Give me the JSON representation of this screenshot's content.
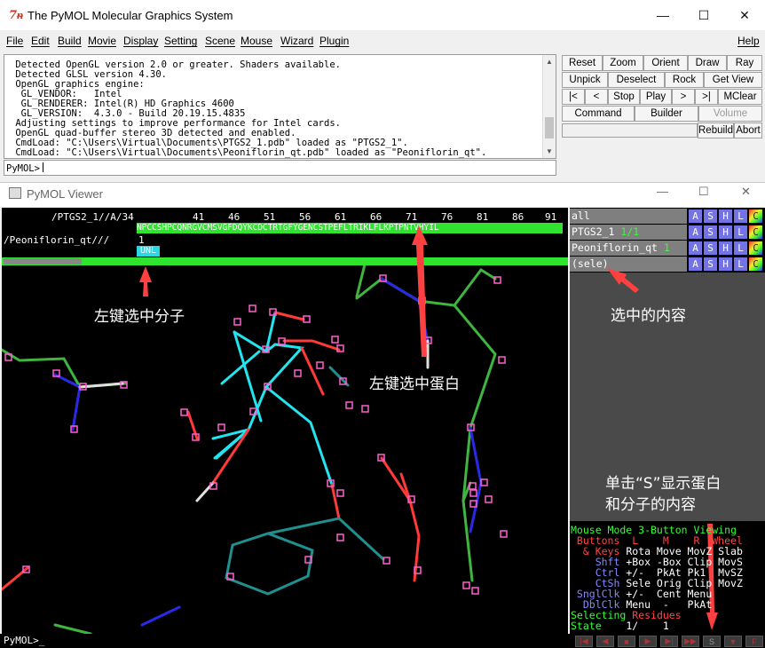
{
  "window": {
    "title": "The PyMOL Molecular Graphics System",
    "minimize": "—",
    "maximize": "☐",
    "close": "✕"
  },
  "menu": [
    "File",
    "Edit",
    "Build",
    "Movie",
    "Display",
    "Setting",
    "Scene",
    "Mouse",
    "Wizard",
    "Plugin"
  ],
  "help_label": "Help",
  "console_lines": [
    " Detected OpenGL version 2.0 or greater. Shaders available.",
    " Detected GLSL version 4.30.",
    " OpenGL graphics engine:",
    "  GL_VENDOR:   Intel",
    "  GL_RENDERER: Intel(R) HD Graphics 4600",
    "  GL_VERSION:  4.3.0 - Build 20.19.15.4835",
    " Adjusting settings to improve performance for Intel cards.",
    " OpenGL quad-buffer stereo 3D detected and enabled.",
    " CmdLoad: \"C:\\Users\\Virtual\\Documents\\PTGS2_1.pdb\" loaded as \"PTGS2_1\".",
    " CmdLoad: \"C:\\Users\\Virtual\\Documents\\Peoniflorin_qt.pdb\" loaded as \"Peoniflorin_qt\"."
  ],
  "cmd_prompt": "PyMOL>",
  "buttons": {
    "row1": [
      "Reset",
      "Zoom",
      "Orient",
      "Draw",
      "Ray"
    ],
    "row2": [
      "Unpick",
      "Deselect",
      "Rock",
      "Get View"
    ],
    "row3": [
      "|<",
      "<",
      "Stop",
      "Play",
      ">",
      ">|",
      "MClear"
    ],
    "row4": [
      "Command",
      "Builder",
      "Volume"
    ],
    "row5": [
      "Rebuild",
      "Abort"
    ]
  },
  "viewer": {
    "title": "PyMOL Viewer",
    "seq_header": "/PTGS2_1//A/34",
    "seq_numbers": [
      "41",
      "46",
      "51",
      "56",
      "61",
      "66",
      "71",
      "76",
      "81",
      "86",
      "91"
    ],
    "seq_residues": "NPCCSHPCQNRGVCMSVGFDQYKCDCTRTGFYGENCSTPEFLTRIKLFLKPTPNTVHYIL",
    "lig_header": "/Peoniflorin_qt///",
    "lig_number": "1",
    "lig_residue": "UNL"
  },
  "objects": [
    {
      "name": "all",
      "extra": ""
    },
    {
      "name": "PTGS2_1",
      "extra": "1/1"
    },
    {
      "name": "Peoniflorin_qt",
      "extra": "1"
    },
    {
      "name": "(sele)",
      "extra": ""
    }
  ],
  "obj_buttons": [
    "A",
    "S",
    "H",
    "L",
    "C"
  ],
  "mouse_mode": {
    "title": "Mouse Mode 3-Button Viewing",
    "buttons_line": " Buttons  L    M    R  Wheel",
    "rows": [
      {
        "k": "  & Keys",
        "v": " Rota Move MovZ Slab"
      },
      {
        "k": "    Shft",
        "v": " +Box -Box Clip MovS"
      },
      {
        "k": "    Ctrl",
        "v": " +/-  PkAt Pk1  MvSZ"
      },
      {
        "k": "    CtSh",
        "v": " Sele Orig Clip MovZ"
      },
      {
        "k": " SnglClk",
        "v": " +/-  Cent Menu"
      },
      {
        "k": "  DblClk",
        "v": " Menu  -   PkAt"
      }
    ],
    "selecting": "Selecting Residues",
    "state": "State    1/    1"
  },
  "bottom_prompt": "PyMOL>_",
  "movie_controls": [
    "|◀",
    "◀",
    "■",
    "▶",
    "▶|",
    "▶▶",
    "S",
    "▼",
    "F"
  ],
  "annotations": {
    "left_click_molecule": "左键选中分子",
    "left_click_protein": "左键选中蛋白",
    "selected_content": "选中的内容",
    "click_s_line1": "单击“S”显示蛋白",
    "click_s_line2": "和分子的内容"
  },
  "colors": {
    "seq_green": "#33ff33",
    "lig_cyan": "#00ffff",
    "annotation_arrow": "#ff3b3b",
    "panel_gray": "#7f7f7f"
  }
}
